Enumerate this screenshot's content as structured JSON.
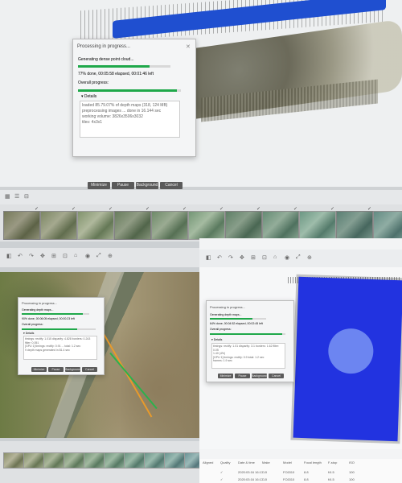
{
  "top_dialog": {
    "title": "Processing in progress...",
    "close": "✕",
    "task_label": "Generating dense point cloud...",
    "task_progress": 0.77,
    "task_status": "77% done, 00:05:58 elapsed, 00:01:46 left",
    "overall_label": "Overall progress:",
    "overall_progress": 0.96,
    "details_label": "Details",
    "details_lines": [
      "loaded 85.79.07% of depth maps (318, 124 MB)",
      "preprocessing images ... done in 16.144 sec",
      "working volume: 3826x3506x3032",
      "tiles: 4x3x1"
    ],
    "buttons": [
      "Minimize",
      "Pause",
      "Background",
      "Cancel"
    ]
  },
  "left_dialog": {
    "title": "Processing in progress...",
    "task_label": "Generating depth maps...",
    "task_progress": 0.9,
    "task_status": "90% done, 00:06:05 elapsed, 00:00:23 left",
    "overall_label": "Overall progress:",
    "overall_progress": 0.75,
    "details_label": "Details",
    "details_lines": [
      "timings: rectify: 1.015 disparity: 4.828 borders: 0.243 filter: 0.051",
      "[GPU 1] timings: rectify: 0.91 ... total: 1.2 sec",
      "9 depth maps generated in 81.4 sec"
    ],
    "buttons": [
      "Minimize",
      "Pause",
      "Background",
      "Cancel"
    ]
  },
  "right_dialog": {
    "title": "Processing in progress...",
    "task_label": "Generating depth maps...",
    "task_progress": 0.75,
    "task_status": "64% done, 00:04:52 elapsed, 00:02:45 left",
    "overall_label": "Overall progress:",
    "overall_progress": 0.96,
    "details_label": "Details",
    "details_lines": [
      "timings: rectify: 1.01 disparity: 3.1 borders: 1.62 filter: 0.05",
      "1.40 (4%)",
      "[GPU 1] timings: rectify: 0.9 total: 1.2 sec",
      "frames: 1.9 sec"
    ],
    "buttons": [
      "Minimize",
      "Pause",
      "Background",
      "Cancel"
    ]
  },
  "thumb_strip": {
    "count": 11,
    "check": "✓"
  },
  "left_thumbs": {
    "count": 10
  },
  "toolbar_icons": [
    "◧",
    "↶",
    "↷",
    "✥",
    "⊞",
    "⊡",
    "⌂",
    "◉",
    "⤢",
    "⊕"
  ],
  "right_table": {
    "headers": [
      "Aligned",
      "Quality",
      "Date & time",
      "Make",
      "Model",
      "Focal length",
      "F-stop",
      "ISO"
    ],
    "row1": [
      "",
      "✓",
      "2020:03:16 16:17",
      "DJI",
      "FC6310",
      "8.8",
      "f/4.5",
      "100"
    ],
    "row2": [
      "",
      "✓",
      "2020:03:16 16:17",
      "DJI",
      "FC6310",
      "8.8",
      "f/4.5",
      "100"
    ]
  },
  "colors": {
    "progress_green": "#1fa84a",
    "model_blue": "#2233e0",
    "water_blue": "#1f4fd0",
    "button_dark": "#5a5a5a"
  }
}
